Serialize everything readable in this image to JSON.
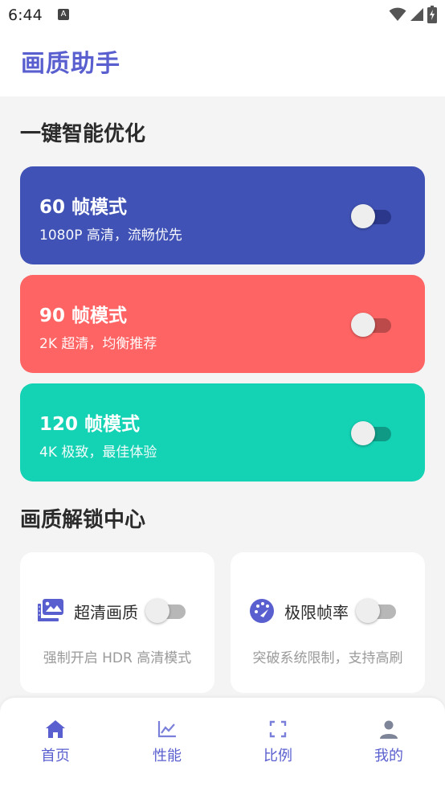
{
  "status_bar": {
    "time": "6:44",
    "notif_letter": "A"
  },
  "app": {
    "title": "画质助手"
  },
  "section_optimize": {
    "title": "一键智能优化",
    "modes": [
      {
        "title": "60 帧模式",
        "subtitle": "1080P 高清，流畅优先",
        "color": "#4052b5",
        "track_color": "#2a378a",
        "enabled": false
      },
      {
        "title": "90 帧模式",
        "subtitle": "2K 超清，均衡推荐",
        "color": "#ff6464",
        "track_color": "#bc4a4a",
        "enabled": false
      },
      {
        "title": "120 帧模式",
        "subtitle": "4K 极致，最佳体验",
        "color": "#14d2b4",
        "track_color": "#0e9a85",
        "enabled": false
      }
    ]
  },
  "section_unlock": {
    "title": "画质解锁中心",
    "features": [
      {
        "label": "超清画质",
        "description": "强制开启 HDR 高清模式",
        "icon": "photo-library-icon",
        "enabled": false
      },
      {
        "label": "极限帧率",
        "description": "突破系统限制，支持高刷",
        "icon": "speedometer-icon",
        "enabled": false
      }
    ]
  },
  "bottom_nav": {
    "active_color": "#5a5fcf",
    "inactive_color": "#5a5fcf",
    "items": [
      {
        "label": "首页",
        "icon": "home-icon",
        "active": true
      },
      {
        "label": "性能",
        "icon": "chart-icon",
        "active": false
      },
      {
        "label": "比例",
        "icon": "fullscreen-icon",
        "active": false
      },
      {
        "label": "我的",
        "icon": "person-icon",
        "active": false
      }
    ]
  }
}
